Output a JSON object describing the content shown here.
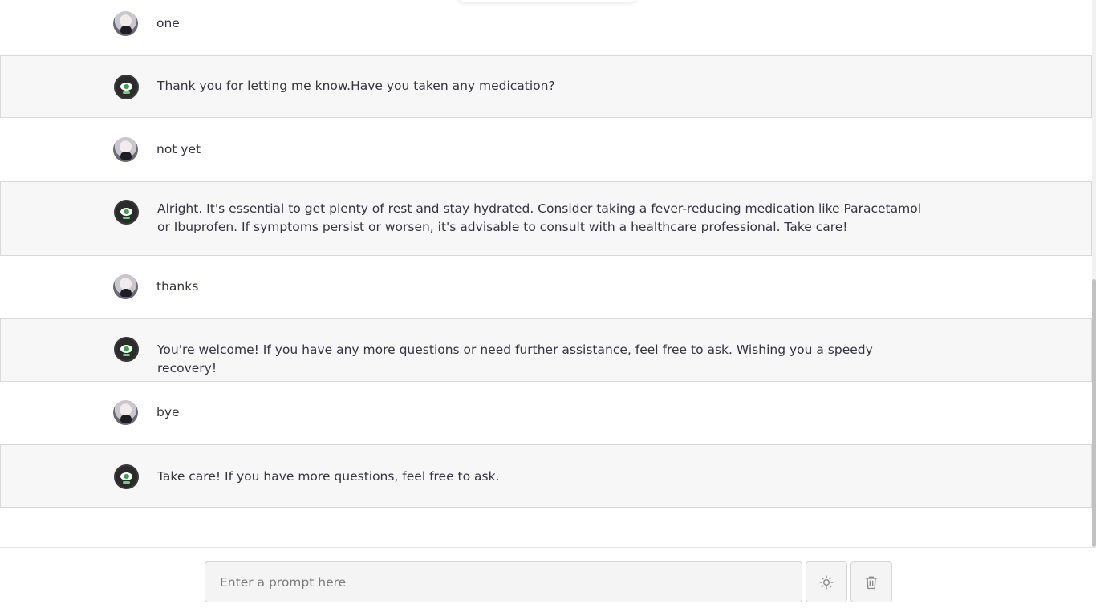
{
  "conversation": {
    "messages": [
      {
        "role": "user",
        "text": "one"
      },
      {
        "role": "assistant",
        "text": "Thank you for letting me know.Have you taken any medication?"
      },
      {
        "role": "user",
        "text": "not yet"
      },
      {
        "role": "assistant",
        "text": "Alright. It's essential to get plenty of rest and stay hydrated. Consider taking a fever-reducing medication like Paracetamol or Ibuprofen. If symptoms persist or worsen, it's advisable to consult with a healthcare professional. Take care!"
      },
      {
        "role": "user",
        "text": "thanks"
      },
      {
        "role": "assistant",
        "text": "You're welcome! If you have any more questions or need further assistance, feel free to ask. Wishing you a speedy recovery!"
      },
      {
        "role": "user",
        "text": "bye"
      },
      {
        "role": "assistant",
        "text": "Take care! If you have more questions, feel free to ask."
      }
    ]
  },
  "composer": {
    "placeholder": "Enter a prompt here",
    "value": "",
    "theme_icon": "sun-icon",
    "clear_icon": "trash-icon"
  },
  "colors": {
    "bot_row_bg": "#f7f7f7",
    "text": "#343541",
    "bot_avatar_eye": "#3aa24a"
  }
}
